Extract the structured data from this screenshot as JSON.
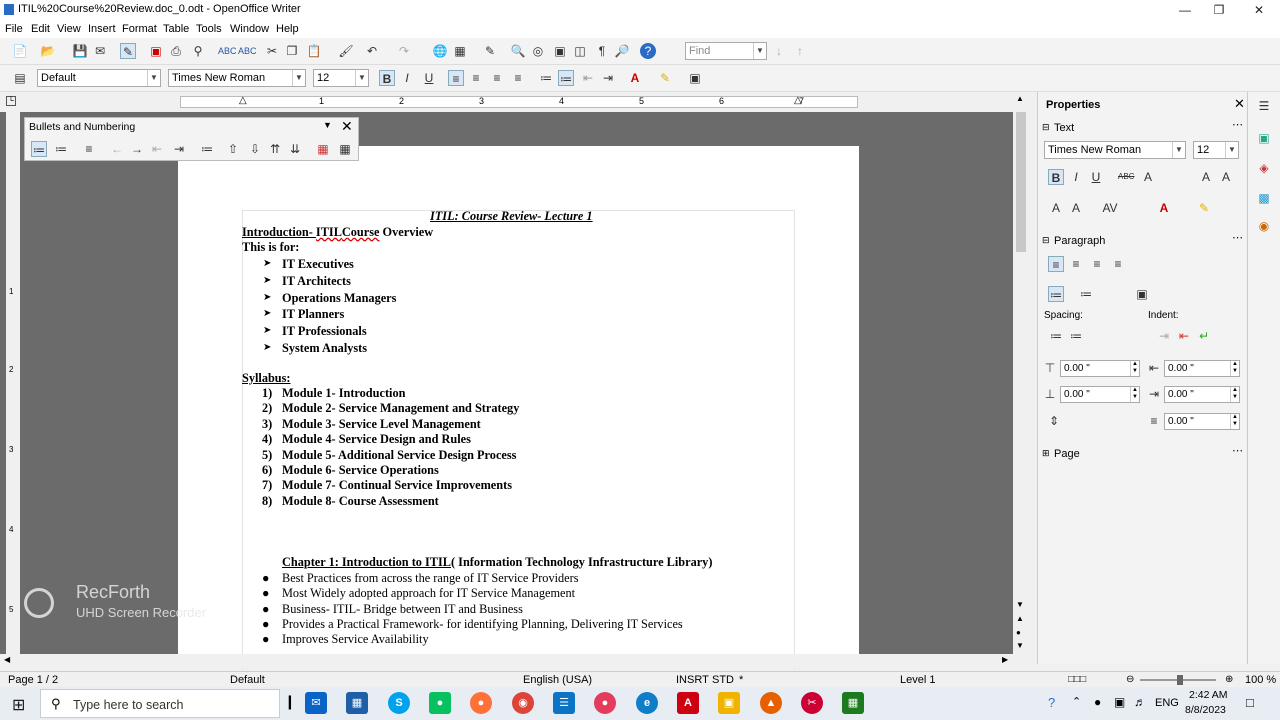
{
  "window": {
    "title": "ITIL%20Course%20Review.doc_0.odt - OpenOffice Writer"
  },
  "menu": [
    "File",
    "Edit",
    "View",
    "Insert",
    "Format",
    "Table",
    "Tools",
    "Window",
    "Help"
  ],
  "find": {
    "placeholder": "Find"
  },
  "formatting": {
    "style": "Default",
    "font": "Times New Roman",
    "size": "12"
  },
  "ruler_numbers": [
    "1",
    "2",
    "3",
    "4",
    "5",
    "6",
    "7"
  ],
  "vruler_numbers": [
    "1",
    "2",
    "3",
    "4",
    "5"
  ],
  "bullets_panel": {
    "title": "Bullets and Numbering"
  },
  "document": {
    "heading": "ITIL: Course Review- Lecture 1",
    "intro_prefix": "Introduction-  ",
    "intro_itil": "ITIL",
    "intro_course": "Course",
    "intro_suffix": " Overview",
    "this_is_for": "This is for:",
    "audience": [
      "IT Executives",
      "IT Architects",
      "Operations Managers",
      "IT Planners",
      "IT Professionals",
      "System Analysts"
    ],
    "syllabus_label": "Syllabus:",
    "modules": [
      {
        "num": "1)",
        "text": "Module 1- Introduction"
      },
      {
        "num": "2)",
        "text": "Module 2- Service Management and Strategy"
      },
      {
        "num": "3)",
        "text": "Module 3- Service Level Management"
      },
      {
        "num": "4)",
        "text": "Module 4- Service Design and Rules"
      },
      {
        "num": "5)",
        "text": "Module 5- Additional Service Design Process"
      },
      {
        "num": "6)",
        "text": "Module 6- Service Operations"
      },
      {
        "num": "7)",
        "text": "Module 7- Continual Service Improvements"
      },
      {
        "num": "8)",
        "text": "Module 8- Course Assessment"
      }
    ],
    "chapter_underlined": "Chapter 1: Introduction to ITIL",
    "chapter_rest": "( Information Technology Infrastructure Library)",
    "chapter_points": [
      "Best Practices from across the range of IT Service Providers",
      "Most Widely adopted approach for IT Service Management",
      "Business- ITIL- Bridge between IT and Business",
      " Provides a Practical Framework- for identifying Planning, Delivering IT Services",
      "Improves Service Availability"
    ]
  },
  "sidebar": {
    "title": "Properties",
    "text_section": "Text",
    "font": "Times New Roman",
    "size": "12",
    "paragraph_section": "Paragraph",
    "spacing_label": "Spacing:",
    "indent_label": "Indent:",
    "spacing_above": "0.00 \"",
    "spacing_below": "0.00 \"",
    "indent_before": "0.00 \"",
    "indent_after": "0.00 \"",
    "indent_first": "0.00 \"",
    "page_section": "Page"
  },
  "status": {
    "page": "Page 1 / 2",
    "style": "Default",
    "language": "English (USA)",
    "insert": "INSRT",
    "selection": "STD",
    "modified": "*",
    "level": "Level 1",
    "zoom": "100 %"
  },
  "watermark": {
    "brand": "RecForth",
    "sub": "UHD Screen Recorder"
  },
  "taskbar": {
    "search_placeholder": "Type here to search",
    "lang": "ENG",
    "time": "2:42 AM",
    "date": "8/8/2023"
  }
}
